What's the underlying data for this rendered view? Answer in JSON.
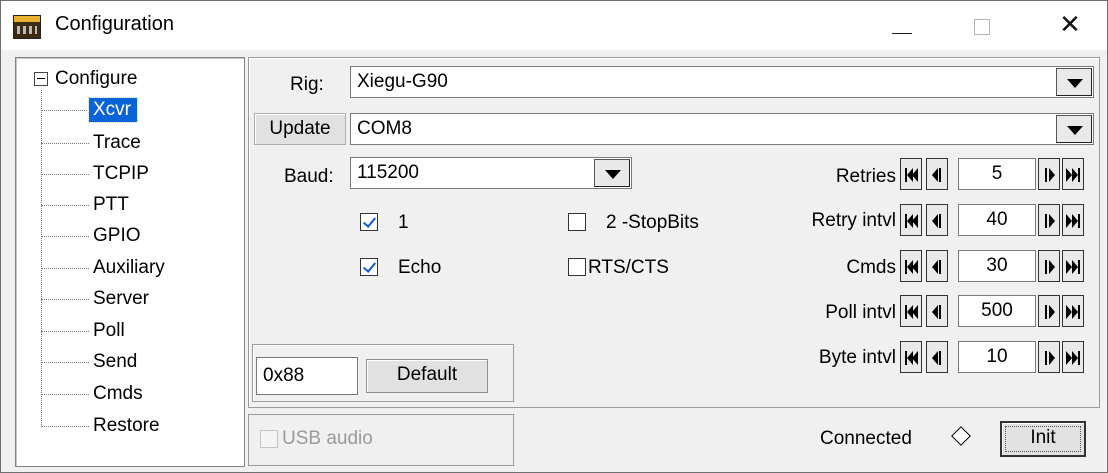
{
  "window": {
    "title": "Configuration",
    "minimize": "—",
    "maximize": "",
    "close": "✕"
  },
  "tree": {
    "root": "Configure",
    "items": [
      {
        "label": "Xcvr",
        "selected": true
      },
      {
        "label": "Trace",
        "selected": false
      },
      {
        "label": "TCPIP",
        "selected": false
      },
      {
        "label": "PTT",
        "selected": false
      },
      {
        "label": "GPIO",
        "selected": false
      },
      {
        "label": "Auxiliary",
        "selected": false
      },
      {
        "label": "Server",
        "selected": false
      },
      {
        "label": "Poll",
        "selected": false
      },
      {
        "label": "Send",
        "selected": false
      },
      {
        "label": "Cmds",
        "selected": false
      },
      {
        "label": "Restore",
        "selected": false
      }
    ]
  },
  "xcvr": {
    "rig_label": "Rig:",
    "rig_value": "Xiegu-G90",
    "update_label": "Update",
    "port_value": "COM8",
    "baud_label": "Baud:",
    "baud_value": "115200",
    "stopbits_1_label": "1",
    "stopbits_1_checked": true,
    "stopbits_2_label": "2 -StopBits",
    "stopbits_2_checked": false,
    "echo_label": "Echo",
    "echo_checked": true,
    "rtscts_label": "RTS/CTS",
    "rtscts_checked": false,
    "civ_address": "0x88",
    "default_label": "Default"
  },
  "spinners": [
    {
      "label": "Retries",
      "value": "5"
    },
    {
      "label": "Retry intvl",
      "value": "40"
    },
    {
      "label": "Cmds",
      "value": "30"
    },
    {
      "label": "Poll intvl",
      "value": "500"
    },
    {
      "label": "Byte intvl",
      "value": "10"
    }
  ],
  "footer": {
    "usb_audio_label": "USB audio",
    "usb_audio_enabled": false,
    "connected_label": "Connected",
    "init_label": "Init"
  },
  "icons": {
    "app": "radio-app-icon",
    "expander": "collapse-minus-icon",
    "dropdown": "triangle-down-icon",
    "first": "double-left-icon",
    "prev": "left-icon",
    "next": "right-icon",
    "last": "double-right-icon",
    "status": "diamond-indicator-icon"
  }
}
